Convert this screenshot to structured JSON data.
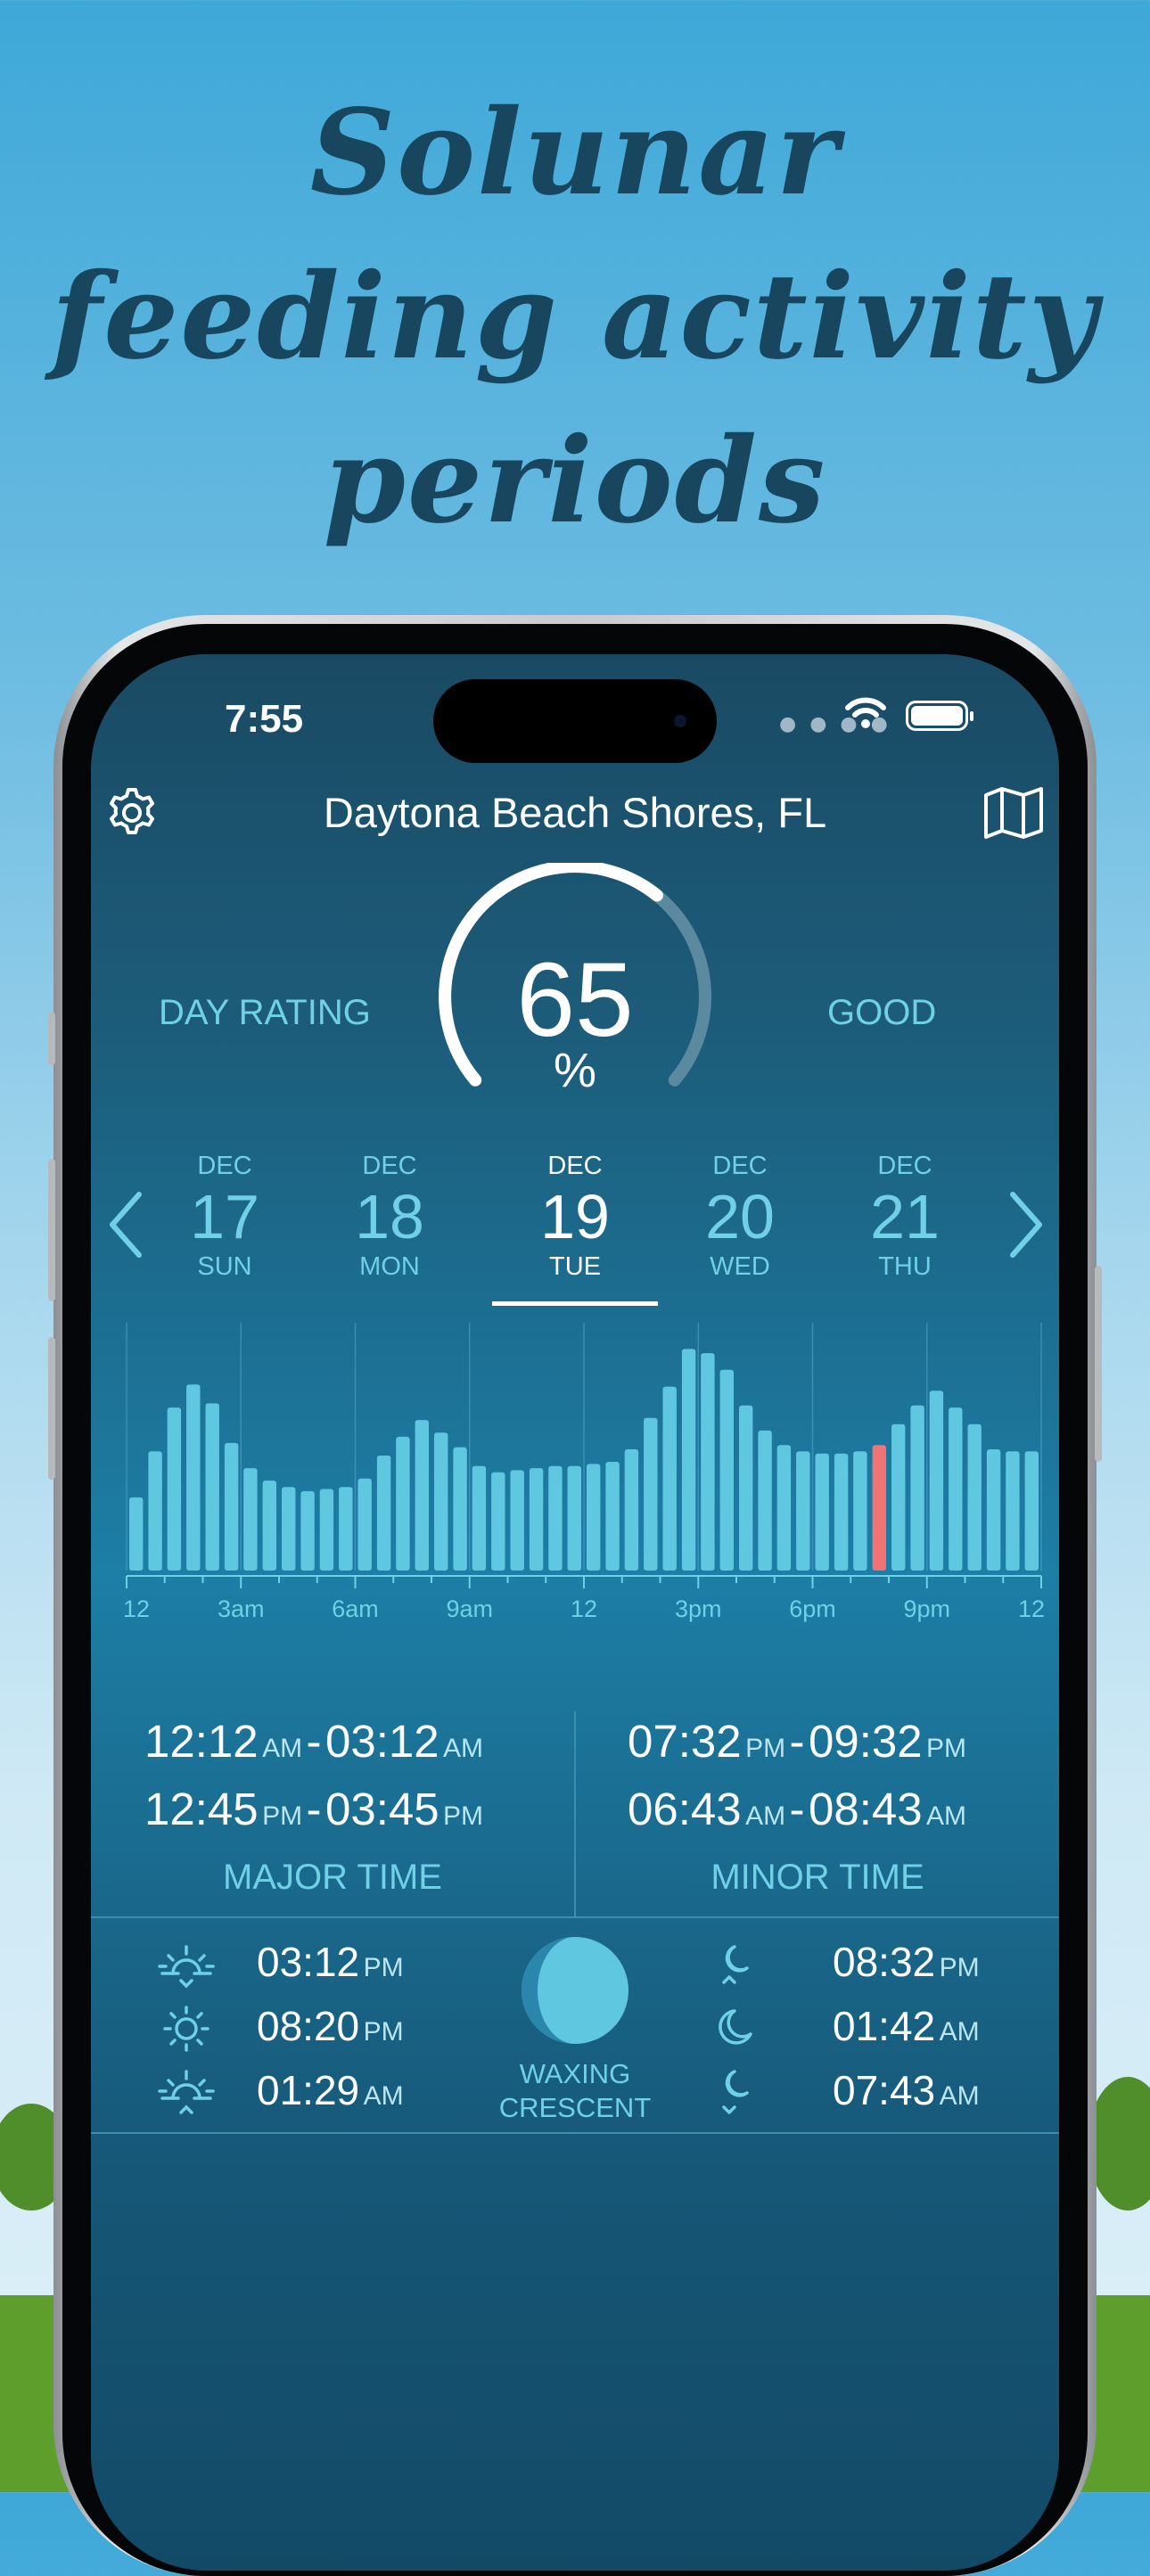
{
  "promo": {
    "headline_lines": [
      "Solunar",
      "feeding activity",
      "periods"
    ]
  },
  "colors": {
    "accent": "#6fd0e6",
    "bar": "#5fc8e0",
    "bar_current": "#f27373",
    "headline": "#17465e"
  },
  "status_bar": {
    "time": "7:55",
    "signal_icon": "signal-dots-icon",
    "wifi_icon": "wifi-icon",
    "battery_icon": "battery-icon"
  },
  "header": {
    "location": "Daytona Beach Shores, FL",
    "left_icon": "gear-icon",
    "right_icon": "map-icon"
  },
  "rating": {
    "label": "DAY RATING",
    "value": "65",
    "unit": "%",
    "word": "GOOD",
    "percent": 65
  },
  "dates": [
    {
      "month": "DEC",
      "day": "17",
      "weekday": "SUN",
      "selected": false
    },
    {
      "month": "DEC",
      "day": "18",
      "weekday": "MON",
      "selected": false
    },
    {
      "month": "DEC",
      "day": "19",
      "weekday": "TUE",
      "selected": true
    },
    {
      "month": "DEC",
      "day": "20",
      "weekday": "WED",
      "selected": false
    },
    {
      "month": "DEC",
      "day": "21",
      "weekday": "THU",
      "selected": false
    }
  ],
  "chart_data": {
    "type": "bar",
    "x_tick_labels": [
      "12",
      "3am",
      "6am",
      "9am",
      "12",
      "3pm",
      "6pm",
      "9pm",
      "12"
    ],
    "values": [
      35,
      57,
      78,
      89,
      80,
      61,
      49,
      43,
      40,
      38,
      39,
      40,
      44,
      55,
      64,
      72,
      66,
      59,
      50,
      47,
      48,
      49,
      50,
      50,
      51,
      52,
      58,
      73,
      88,
      106,
      104,
      96,
      79,
      67,
      60,
      57,
      56,
      56,
      57,
      60,
      70,
      79,
      86,
      78,
      70,
      58,
      57,
      57
    ],
    "highlight_index": 39,
    "ylim": [
      0,
      110
    ]
  },
  "major": {
    "label": "MAJOR TIME",
    "periods": [
      {
        "start": "12:12",
        "start_ampm": "AM",
        "sep": "-",
        "end": "03:12",
        "end_ampm": "AM"
      },
      {
        "start": "12:45",
        "start_ampm": "PM",
        "sep": "-",
        "end": "03:45",
        "end_ampm": "PM"
      }
    ]
  },
  "minor": {
    "label": "MINOR TIME",
    "periods": [
      {
        "start": "07:32",
        "start_ampm": "PM",
        "sep": "-",
        "end": "09:32",
        "end_ampm": "PM"
      },
      {
        "start": "06:43",
        "start_ampm": "AM",
        "sep": "-",
        "end": "08:43",
        "end_ampm": "AM"
      }
    ]
  },
  "sun": [
    {
      "icon": "sunset-icon",
      "time": "03:12",
      "ampm": "PM"
    },
    {
      "icon": "sun-icon",
      "time": "08:20",
      "ampm": "PM"
    },
    {
      "icon": "sunrise-icon",
      "time": "01:29",
      "ampm": "AM"
    }
  ],
  "moon_phase": {
    "icon": "waxing-crescent-moon-icon",
    "line1": "WAXING",
    "line2": "CRESCENT"
  },
  "moon": [
    {
      "icon": "moonrise-icon",
      "time": "08:32",
      "ampm": "PM"
    },
    {
      "icon": "moon-icon",
      "time": "01:42",
      "ampm": "AM"
    },
    {
      "icon": "moonset-icon",
      "time": "07:43",
      "ampm": "AM"
    }
  ]
}
